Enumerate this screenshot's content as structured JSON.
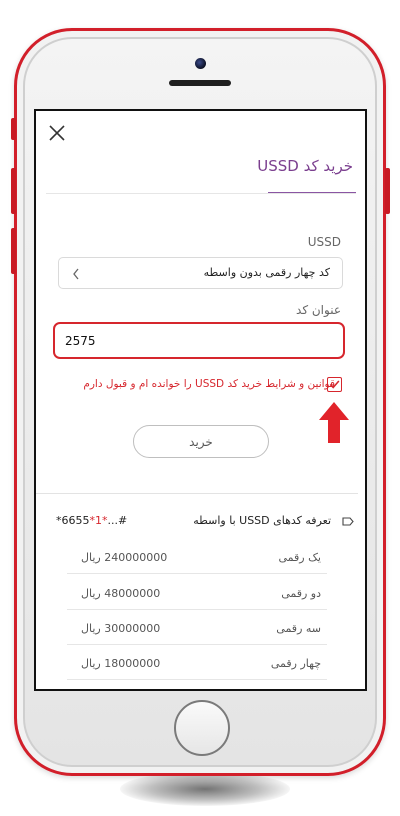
{
  "header": {
    "title": "خرید کد USSD"
  },
  "form": {
    "ussd_label": "USSD",
    "ussd_select_value": "کد چهار رقمی بدون واسطه",
    "code_title_label": "عنوان کد",
    "code_value": "2575",
    "terms_checked": true,
    "terms_text": "قوانین و شرایط خرید کد USSD را خوانده ام و قبول دارم",
    "buy_label": "خرید"
  },
  "rates": {
    "title": "تعرفه کدهای USSD با واسطه",
    "code_prefix": "*6655",
    "code_star": "*1*",
    "code_suffix": "...#",
    "rows": [
      {
        "label": "یک رقمی",
        "price": "240000000 ریال"
      },
      {
        "label": "دو رقمی",
        "price": "48000000 ریال"
      },
      {
        "label": "سه رقمی",
        "price": "30000000 ریال"
      },
      {
        "label": "چهار رقمی",
        "price": "18000000 ریال"
      }
    ]
  },
  "colors": {
    "accent_purple": "#7b3f8f",
    "highlight_red": "#d6262d",
    "phone_frame_red": "#d21f2a"
  },
  "icons": [
    "close-icon",
    "chevron-left-icon",
    "checkmark-icon",
    "arrow-up-icon",
    "collapse-icon"
  ]
}
